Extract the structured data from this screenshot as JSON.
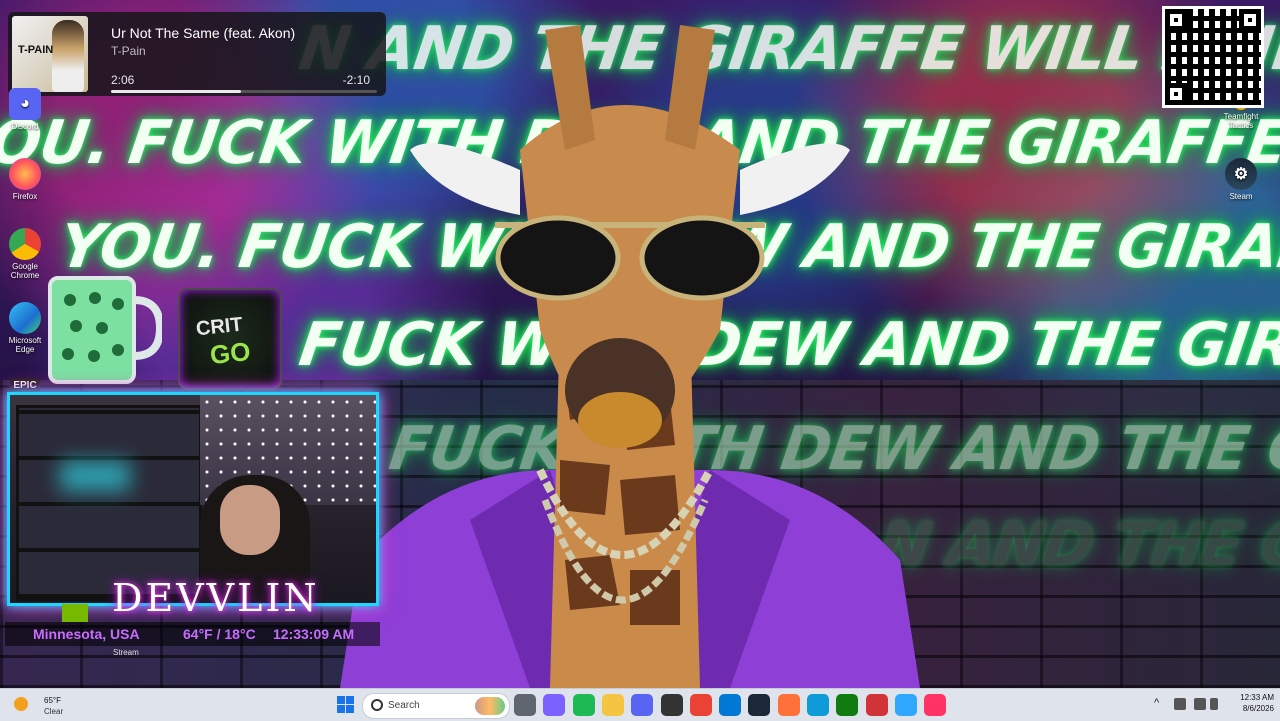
{
  "media": {
    "album_art_text": "T-PAIN",
    "title": "Ur Not The Same (feat. Akon)",
    "artist": "T-Pain",
    "elapsed": "2:06",
    "remaining": "-2:10",
    "progress_fraction": 0.49
  },
  "wallpaper": {
    "graffiti_lines": [
      "N AND THE GIRAFFE WILL FIND",
      "OU. FUCK WITH DEW AND THE GIRAFFE WILL FIND Y",
      "YOU. FUCK WITH DEW AND THE GIRAFFE WILL FIN",
      "FUCK WITH DEW AND THE GIRAFFE WIL",
      "FUCK WITH DEW AND THE GIRAFFE",
      "N AND THE GIRA"
    ],
    "accent_glow": "#2dff6a"
  },
  "desktop_icons": {
    "discord": "Discord",
    "firefox": "Firefox",
    "chrome": "Google Chrome",
    "edge": "Microsoft Edge",
    "epic": "EPIC",
    "teamfight": "Teamfight Tactics",
    "steam": "Steam"
  },
  "overlay": {
    "crit_line1": "CRIT",
    "crit_line2": "GO",
    "streamer_name": "DEVVLIN",
    "location": "Minnesota, USA",
    "weather_temp": "64°F / 18°C",
    "weather_time": "12:33:09 AM",
    "stream_label": "Stream",
    "webcam_border_color": "#1fd6ff",
    "webcam_glow_color": "#ff2fd1"
  },
  "taskbar": {
    "weather_temp": "65°F",
    "weather_condition": "Clear",
    "search_placeholder": "Search",
    "apps": [
      "task-view",
      "copilot",
      "spotify",
      "file-explorer",
      "discord",
      "obs",
      "chrome",
      "store",
      "steam",
      "firefox",
      "edge",
      "xbox",
      "snipping-tool",
      "photoshop",
      "indesign"
    ],
    "app_colors": [
      "#5f6670",
      "#7b61ff",
      "#1db954",
      "#f4c542",
      "#5865f2",
      "#333333",
      "#ea4335",
      "#0078d4",
      "#1b2838",
      "#ff7139",
      "#0f9ad8",
      "#107c10",
      "#d13438",
      "#31a8ff",
      "#ff3366"
    ],
    "clock_time": "12:33 AM",
    "clock_date": "8/6/2026"
  }
}
